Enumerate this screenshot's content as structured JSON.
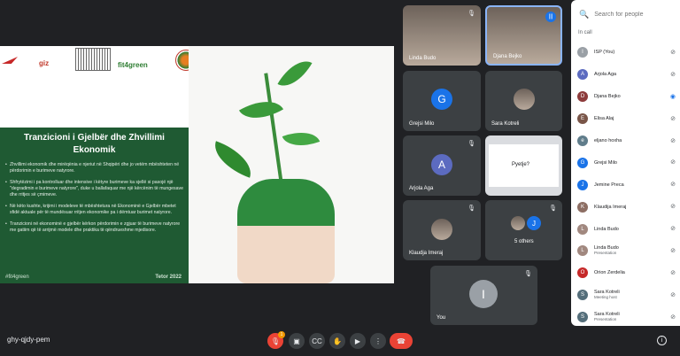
{
  "slide": {
    "logo_giz": "giz",
    "logo_fit": "fit4green",
    "title": "Tranzicioni i Gjelbër dhe Zhvillimi Ekonomik",
    "bullets": [
      "Zhvillimi ekonomik dhe mirëqënia e njeriut në Shqipëri dhe jo vetëm mbështeten në përdorimin e burimeve natyrore.",
      "Shfrytëzimi i pa kontrolluar dhe intensive i këtyre burimeve ka sjellë si pasojë një \"degradimin e burimeve natyrore\", duke u ballafaquar me një kërcënim të mungesave dhe rritjes së çmimeve.",
      "Në këto kushte, krijimi i modeleve të mbështetura në Ekonominë e Gjelbër mbetet sfidë aktuale për të mundësuar rritjen ekonomike pa i dëmtuar burimet natyrore.",
      "Tranzicioni në ekonominë e gjelbër kërkon përdorimin e zgjuar të burimeve natyrore me gatiim që të arrijmë modele dhe praktika të qëndrueshme mjedisore."
    ],
    "hashtag": "#fit4green",
    "date": "Tetor 2022"
  },
  "tiles": [
    {
      "name": "Linda Budo",
      "type": "camera"
    },
    {
      "name": "Djana Bejko",
      "type": "camera"
    },
    {
      "name": "Grejsi Milo",
      "type": "avatar",
      "initial": "G",
      "color": "#1a73e8"
    },
    {
      "name": "Sara Kotreli",
      "type": "camera"
    },
    {
      "name": "Arjola Aga",
      "type": "avatar",
      "initial": "A",
      "color": "#5c6bc0"
    },
    {
      "name": "Pyetje?",
      "type": "presentation"
    },
    {
      "name": "Klaudja Imeraj",
      "type": "camera"
    },
    {
      "name": "5 others",
      "type": "others",
      "initial": "J"
    },
    {
      "name": "You",
      "type": "avatar",
      "initial": "I",
      "color": "#9aa0a6"
    }
  ],
  "bottom_bar": {
    "meeting_code": "ghy-qjdy-pem",
    "notification_count": "1"
  },
  "people_panel": {
    "search_placeholder": "Search for people",
    "section_label": "In call",
    "participants": [
      {
        "name": "ISP (You)",
        "initial": "I",
        "color": "#9aa0a6",
        "mic": "muted"
      },
      {
        "name": "Arjola Aga",
        "initial": "A",
        "color": "#5c6bc0",
        "mic": "muted"
      },
      {
        "name": "Djana Bejko",
        "initial": "D",
        "color": "#8d3b3b",
        "mic": "active"
      },
      {
        "name": "Elisa Alaj",
        "initial": "E",
        "color": "#795548",
        "mic": "muted"
      },
      {
        "name": "eljano hoxha",
        "initial": "e",
        "color": "#607d8b",
        "mic": "muted"
      },
      {
        "name": "Grejsi Milo",
        "initial": "G",
        "color": "#1a73e8",
        "mic": "muted"
      },
      {
        "name": "Jemine Preca",
        "initial": "J",
        "color": "#1a73e8",
        "mic": "muted"
      },
      {
        "name": "Klaudija Imeraj",
        "initial": "K",
        "color": "#8d6e63",
        "mic": "muted"
      },
      {
        "name": "Linda Budo",
        "initial": "L",
        "color": "#a1887f",
        "mic": "muted"
      },
      {
        "name": "Linda Budo",
        "sub": "Presentation",
        "initial": "L",
        "color": "#a1887f",
        "mic": "muted"
      },
      {
        "name": "Orion Zerdelia",
        "initial": "O",
        "color": "#c62828",
        "mic": "muted"
      },
      {
        "name": "Sara Kotreli",
        "sub": "Meeting host",
        "initial": "S",
        "color": "#546e7a",
        "mic": "muted"
      },
      {
        "name": "Sara Kotreli",
        "sub": "Presentation",
        "initial": "S",
        "color": "#546e7a",
        "mic": "muted"
      }
    ]
  }
}
